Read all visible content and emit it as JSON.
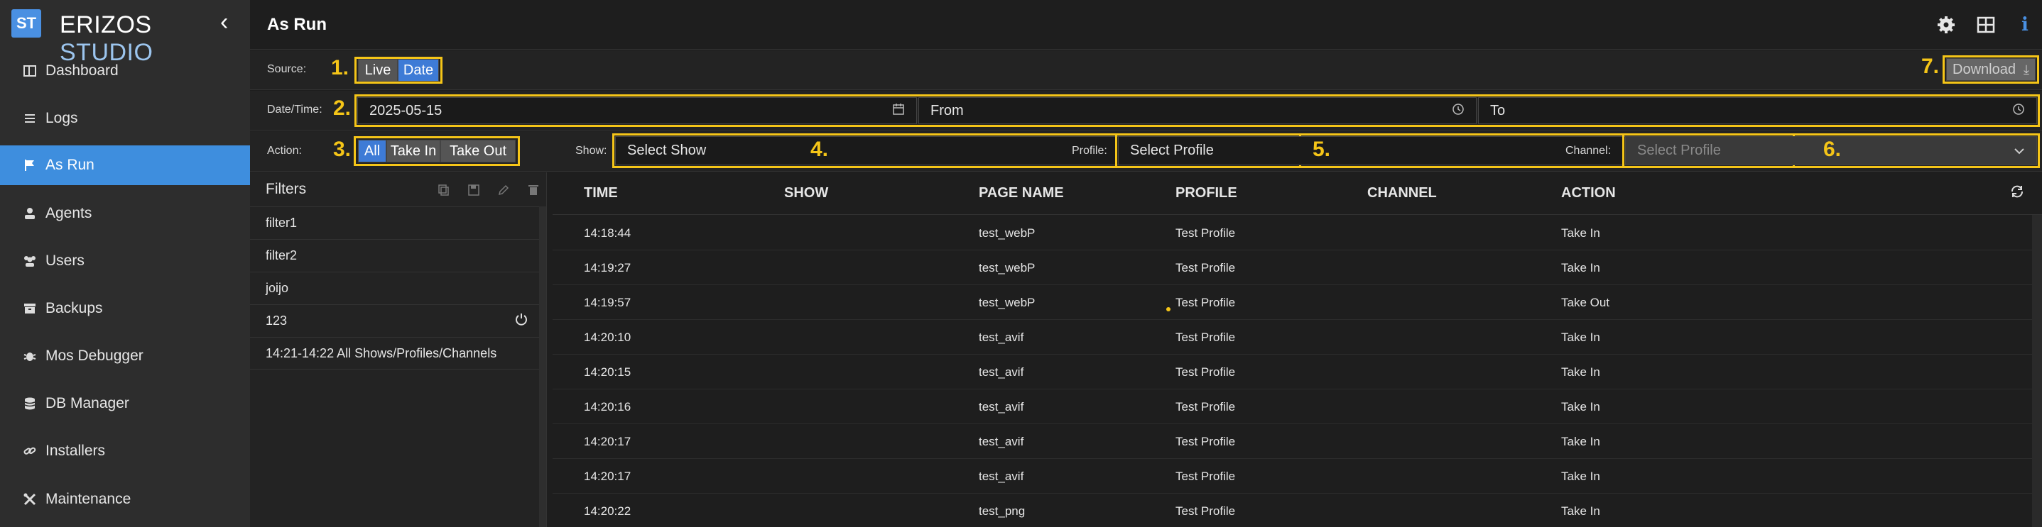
{
  "brand": {
    "logo": "ST",
    "name_main": "ERIZOS",
    "name_sub": "STUDIO"
  },
  "sidebar": {
    "items": [
      {
        "label": "Dashboard",
        "icon": "dashboard-icon"
      },
      {
        "label": "Logs",
        "icon": "list-icon"
      },
      {
        "label": "As Run",
        "icon": "flag-icon",
        "active": true
      },
      {
        "label": "Agents",
        "icon": "agent-icon"
      },
      {
        "label": "Users",
        "icon": "users-icon"
      },
      {
        "label": "Backups",
        "icon": "archive-icon"
      },
      {
        "label": "Mos Debugger",
        "icon": "bug-icon"
      },
      {
        "label": "DB Manager",
        "icon": "database-icon"
      },
      {
        "label": "Installers",
        "icon": "link-icon"
      },
      {
        "label": "Maintenance",
        "icon": "tools-icon"
      }
    ]
  },
  "header": {
    "title": "As Run"
  },
  "source": {
    "label": "Source:",
    "options": [
      "Live",
      "Date"
    ],
    "selected": "Date",
    "marker": "1."
  },
  "download": {
    "label": "Download",
    "marker": "7."
  },
  "datetime": {
    "label": "Date/Time:",
    "date": "2025-05-15",
    "from": "From",
    "to": "To",
    "marker": "2."
  },
  "action": {
    "label": "Action:",
    "options": [
      "All",
      "Take In",
      "Take Out"
    ],
    "selected": "All",
    "marker": "3."
  },
  "show": {
    "label": "Show:",
    "value": "Select Show",
    "marker": "4."
  },
  "profile": {
    "label": "Profile:",
    "value": "Select Profile",
    "marker": "5."
  },
  "channel": {
    "label": "Channel:",
    "value": "Select Profile",
    "marker": "6."
  },
  "filters": {
    "title": "Filters",
    "items": [
      "filter1",
      "filter2",
      "joijo",
      "123",
      "14:21-14:22 All Shows/Profiles/Channels"
    ]
  },
  "table": {
    "columns": [
      "TIME",
      "SHOW",
      "PAGE NAME",
      "PROFILE",
      "CHANNEL",
      "ACTION"
    ],
    "rows": [
      [
        "14:18:44",
        "",
        "test_webP",
        "Test Profile",
        "",
        "Take In"
      ],
      [
        "14:19:27",
        "",
        "test_webP",
        "Test Profile",
        "",
        "Take In"
      ],
      [
        "14:19:57",
        "",
        "test_webP",
        "Test Profile",
        "",
        "Take Out"
      ],
      [
        "14:20:10",
        "",
        "test_avif",
        "Test Profile",
        "",
        "Take In"
      ],
      [
        "14:20:15",
        "",
        "test_avif",
        "Test Profile",
        "",
        "Take In"
      ],
      [
        "14:20:16",
        "",
        "test_avif",
        "Test Profile",
        "",
        "Take In"
      ],
      [
        "14:20:17",
        "",
        "test_avif",
        "Test Profile",
        "",
        "Take In"
      ],
      [
        "14:20:17",
        "",
        "test_avif",
        "Test Profile",
        "",
        "Take In"
      ],
      [
        "14:20:22",
        "",
        "test_png",
        "Test Profile",
        "",
        "Take In"
      ]
    ]
  },
  "colors": {
    "accent": "#3e8ede",
    "marker": "#f5c518",
    "sidebar_bg": "#2d2d2d"
  }
}
